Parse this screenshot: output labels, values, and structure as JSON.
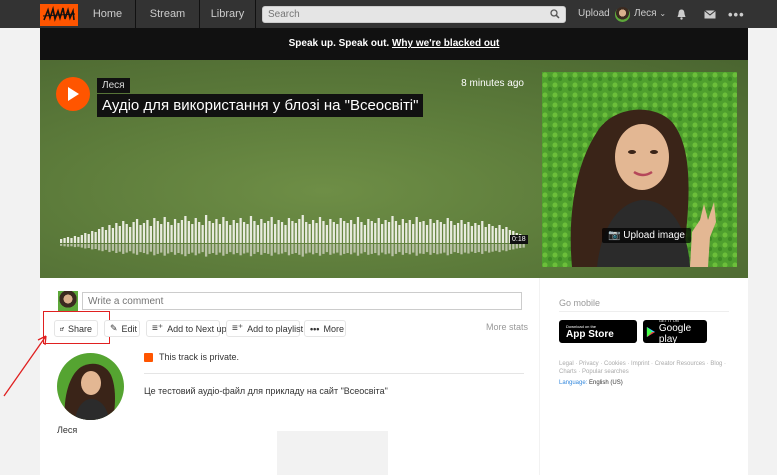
{
  "topbar": {
    "nav": [
      "Home",
      "Stream",
      "Library"
    ],
    "search_placeholder": "Search",
    "upload": "Upload",
    "username": "Леся"
  },
  "banner": {
    "text": "Speak up. Speak out. ",
    "link": "Why we're blacked out"
  },
  "track": {
    "user": "Леся",
    "title": "Аудіо для використання у блозі на \"Всеосвіті\"",
    "time_ago": "8 minutes ago",
    "duration": "0:18",
    "upload_image": "Upload image",
    "waveform_heights": [
      4,
      5,
      6,
      5,
      7,
      6,
      8,
      10,
      9,
      12,
      11,
      14,
      16,
      13,
      18,
      15,
      20,
      17,
      22,
      19,
      16,
      21,
      24,
      18,
      20,
      23,
      17,
      25,
      22,
      19,
      26,
      21,
      18,
      24,
      20,
      23,
      27,
      22,
      19,
      25,
      21,
      18,
      28,
      22,
      20,
      24,
      19,
      26,
      22,
      18,
      23,
      20,
      25,
      21,
      19,
      27,
      22,
      18,
      24,
      20,
      22,
      26,
      19,
      23,
      21,
      18,
      25,
      22,
      20,
      24,
      28,
      21,
      19,
      23,
      20,
      26,
      22,
      18,
      24,
      21,
      19,
      25,
      22,
      20,
      23,
      19,
      26,
      21,
      18,
      24,
      22,
      20,
      25,
      19,
      23,
      21,
      27,
      22,
      18,
      24,
      20,
      23,
      19,
      26,
      21,
      22,
      18,
      24,
      20,
      23,
      21,
      19,
      25,
      22,
      18,
      20,
      23,
      19,
      21,
      17,
      20,
      18,
      22,
      16,
      19,
      17,
      15,
      18,
      14,
      16,
      13,
      12,
      10,
      9,
      8
    ]
  },
  "comment": {
    "placeholder": "Write a comment"
  },
  "actions": {
    "share": "Share",
    "edit": "Edit",
    "next_up": "Add to Next up",
    "playlist": "Add to playlist",
    "more": "More",
    "more_stats": "More stats"
  },
  "privacy": "This track is private.",
  "description": "Це тестовий аудіо-файл для прикладу на сайт \"Всеосвіта\"",
  "uploader_name": "Леся",
  "sidebar": {
    "go_mobile": "Go mobile",
    "appstore_small": "Download on the",
    "appstore_big": "App Store",
    "gplay_small": "GET IT ON",
    "gplay_big": "Google play",
    "footer_links": "Legal · Privacy · Cookies · Imprint · Creator Resources · Blog · Charts · Popular searches",
    "language_label": "Language:",
    "language_value": "English (US)"
  },
  "colors": {
    "brand": "#ff5500",
    "topbar": "#333333",
    "annotation": "#e02020"
  }
}
